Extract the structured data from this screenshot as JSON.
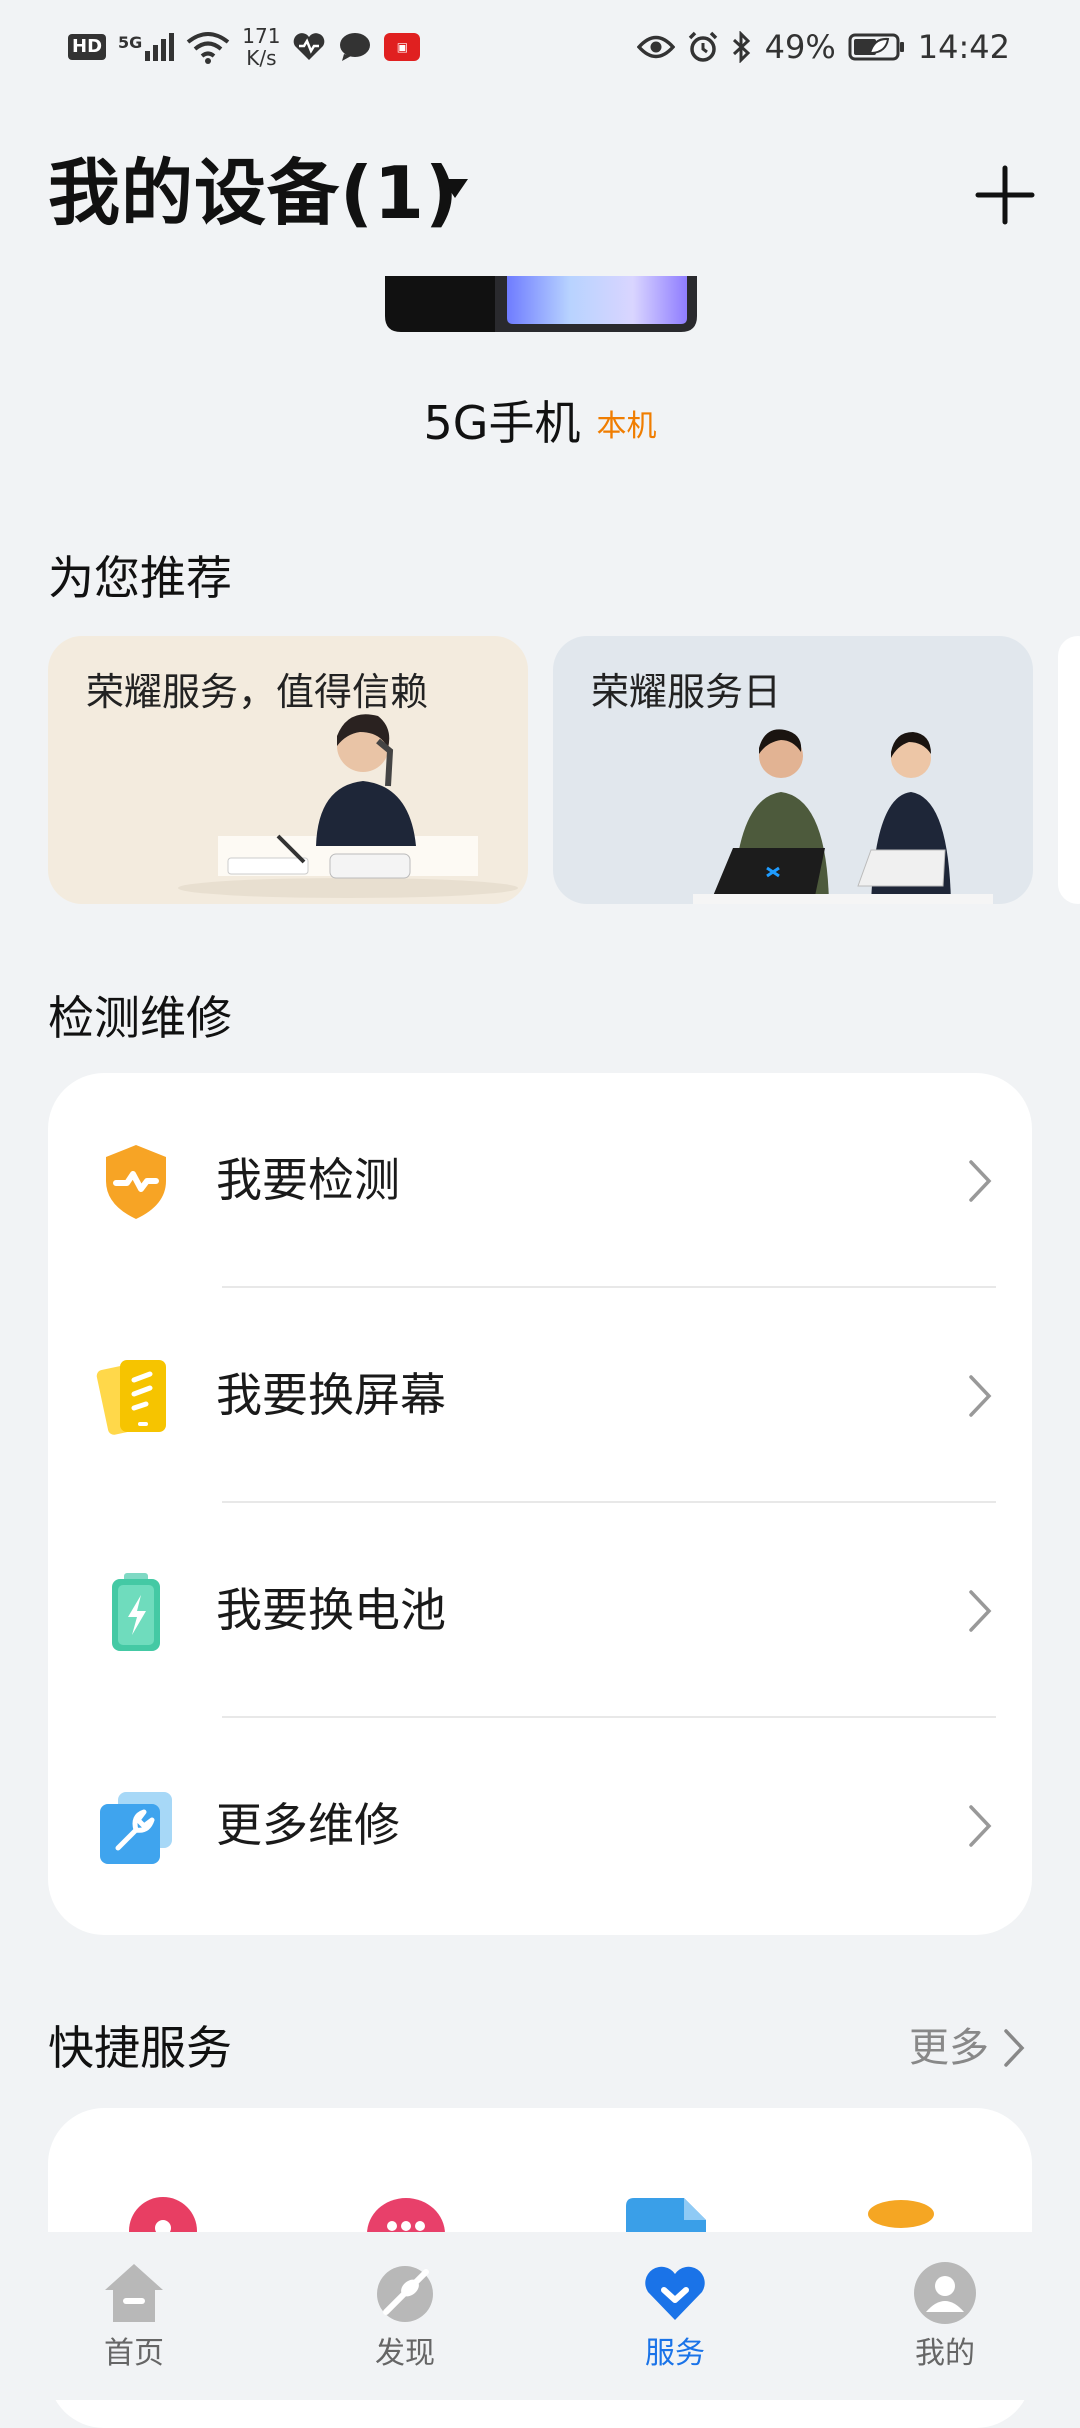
{
  "status_bar": {
    "hd": "HD",
    "signal": "5G",
    "net_speed_value": "171",
    "net_speed_unit": "K/s",
    "battery": "49%",
    "time": "14:42"
  },
  "header": {
    "title": "我的设备(1)"
  },
  "device": {
    "name": "5G手机",
    "tag": "本机"
  },
  "recommend": {
    "title": "为您推荐",
    "cards": [
      {
        "label": "荣耀服务，值得信赖"
      },
      {
        "label": "荣耀服务日"
      }
    ]
  },
  "repair": {
    "title": "检测维修",
    "items": [
      {
        "label": "我要检测",
        "icon": "shield-check-icon"
      },
      {
        "label": "我要换屏幕",
        "icon": "screen-icon"
      },
      {
        "label": "我要换电池",
        "icon": "battery-icon"
      },
      {
        "label": "更多维修",
        "icon": "wrench-icon"
      }
    ]
  },
  "quick": {
    "title": "快捷服务",
    "more": "更多"
  },
  "bottom_nav": {
    "items": [
      {
        "label": "首页",
        "icon": "home-icon"
      },
      {
        "label": "发现",
        "icon": "discover-icon"
      },
      {
        "label": "服务",
        "icon": "service-heart-icon",
        "active": true
      },
      {
        "label": "我的",
        "icon": "profile-icon"
      }
    ]
  },
  "colors": {
    "accent": "#1a73e8",
    "tag": "#f07d00",
    "background": "#f1f3f5"
  }
}
